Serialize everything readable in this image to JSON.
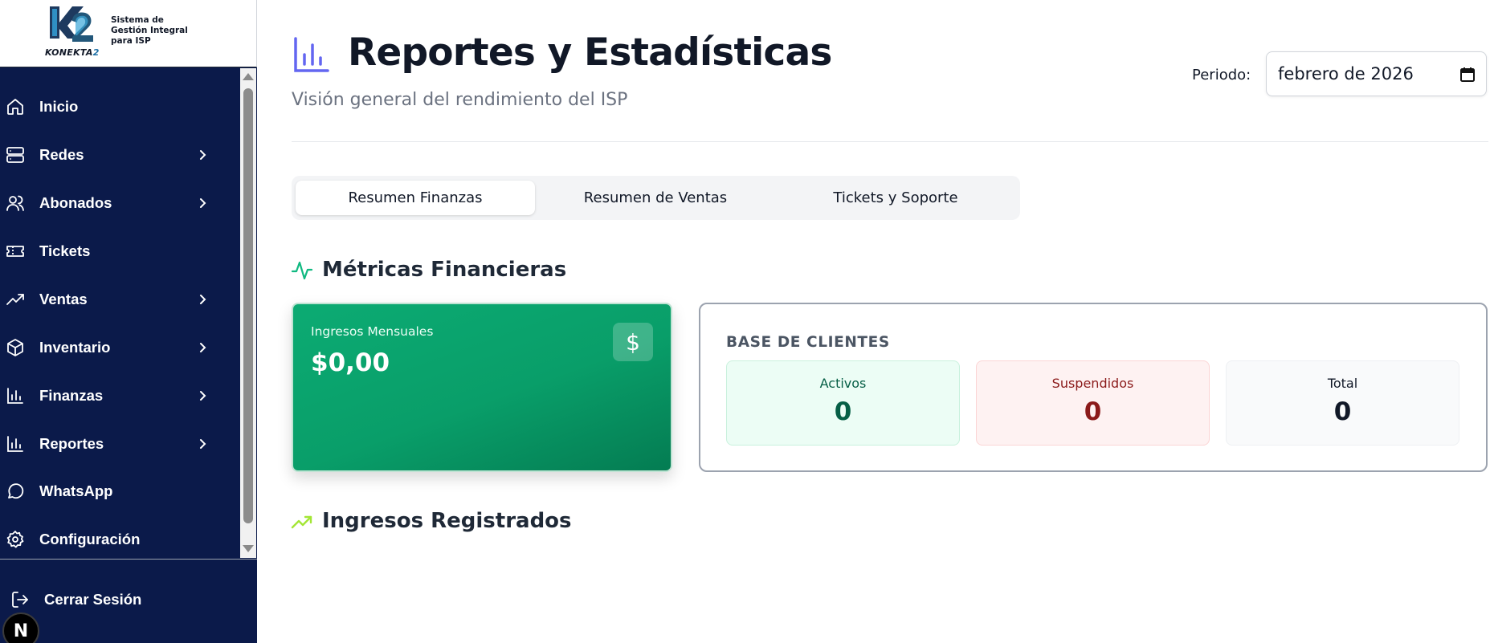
{
  "app": {
    "logo_word": "KONEKTA",
    "logo_word_suffix": "2",
    "tagline_lines": [
      "Sistema de",
      "Gestión Integral",
      "para ISP"
    ]
  },
  "sidebar": {
    "items": [
      {
        "label": "Inicio",
        "icon": "home-icon",
        "has_submenu": false
      },
      {
        "label": "Redes",
        "icon": "server-icon",
        "has_submenu": true
      },
      {
        "label": "Abonados",
        "icon": "users-icon",
        "has_submenu": true
      },
      {
        "label": "Tickets",
        "icon": "ticket-icon",
        "has_submenu": false
      },
      {
        "label": "Ventas",
        "icon": "trending-up-icon",
        "has_submenu": true
      },
      {
        "label": "Inventario",
        "icon": "box-icon",
        "has_submenu": true
      },
      {
        "label": "Finanzas",
        "icon": "bar-chart-icon",
        "has_submenu": true
      },
      {
        "label": "Reportes",
        "icon": "bar-chart-icon",
        "has_submenu": true
      },
      {
        "label": "WhatsApp",
        "icon": "chat-bubble-icon",
        "has_submenu": false
      },
      {
        "label": "Configuración",
        "icon": "gear-icon",
        "has_submenu": false
      }
    ],
    "logout_label": "Cerrar Sesión",
    "dev_badge": "N"
  },
  "header": {
    "title": "Reportes y Estadísticas",
    "subtitle": "Visión general del rendimiento del ISP",
    "period_label": "Periodo:",
    "period_value": "febrero de 2026"
  },
  "tabs": [
    {
      "label": "Resumen Finanzas",
      "active": true
    },
    {
      "label": "Resumen de Ventas",
      "active": false
    },
    {
      "label": "Tickets y Soporte",
      "active": false
    }
  ],
  "financial": {
    "section_title": "Métricas Financieras",
    "income_label": "Ingresos Mensuales",
    "income_value": "$0,00",
    "income_icon": "$",
    "clients": {
      "heading": "BASE DE CLIENTES",
      "active_label": "Activos",
      "active_value": "0",
      "suspended_label": "Suspendidos",
      "suspended_value": "0",
      "total_label": "Total",
      "total_value": "0"
    }
  },
  "registered": {
    "section_title": "Ingresos Registrados"
  },
  "colors": {
    "sidebar_bg": "#0b1a4a",
    "accent_indigo": "#6366f1",
    "income_green": "#0cab73",
    "trend_lime": "#a3e635",
    "activity_green": "#10b981"
  }
}
